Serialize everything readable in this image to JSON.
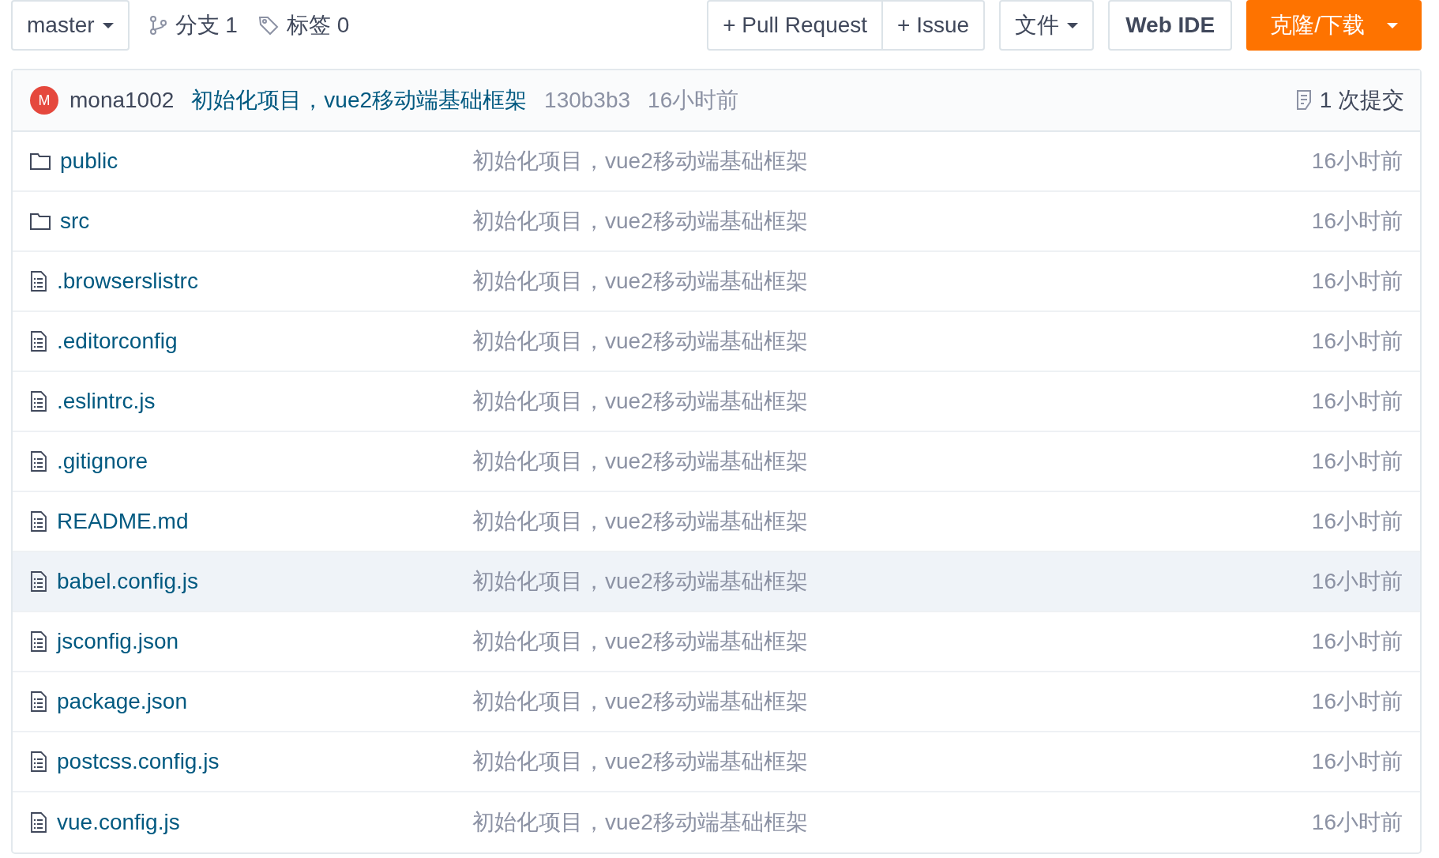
{
  "toolbar": {
    "branch": "master",
    "branches": "分支 1",
    "tags": "标签 0",
    "buttons": [
      {
        "label": "+ Pull Request",
        "kind": "group"
      },
      {
        "label": "+ Issue",
        "kind": "group"
      },
      {
        "label": "文件",
        "kind": "dropdown"
      },
      {
        "label": "Web IDE",
        "kind": "bold"
      },
      {
        "label": "克隆/下载",
        "kind": "primary"
      }
    ]
  },
  "commit": {
    "avatar": "M",
    "author": "mona1002",
    "message": "初始化项目，vue2移动端基础框架",
    "hash": "130b3b3",
    "time": "16小时前",
    "count": "1 次提交"
  },
  "files": [
    {
      "name": "public",
      "kind": "folder",
      "message": "初始化项目，vue2移动端基础框架",
      "time": "16小时前",
      "highlighted": false
    },
    {
      "name": "src",
      "kind": "folder",
      "message": "初始化项目，vue2移动端基础框架",
      "time": "16小时前",
      "highlighted": false
    },
    {
      "name": ".browserslistrc",
      "kind": "file",
      "message": "初始化项目，vue2移动端基础框架",
      "time": "16小时前",
      "highlighted": false
    },
    {
      "name": ".editorconfig",
      "kind": "file",
      "message": "初始化项目，vue2移动端基础框架",
      "time": "16小时前",
      "highlighted": false
    },
    {
      "name": ".eslintrc.js",
      "kind": "file",
      "message": "初始化项目，vue2移动端基础框架",
      "time": "16小时前",
      "highlighted": false
    },
    {
      "name": ".gitignore",
      "kind": "file",
      "message": "初始化项目，vue2移动端基础框架",
      "time": "16小时前",
      "highlighted": false
    },
    {
      "name": "README.md",
      "kind": "file",
      "message": "初始化项目，vue2移动端基础框架",
      "time": "16小时前",
      "highlighted": false
    },
    {
      "name": "babel.config.js",
      "kind": "file",
      "message": "初始化项目，vue2移动端基础框架",
      "time": "16小时前",
      "highlighted": true
    },
    {
      "name": "jsconfig.json",
      "kind": "file",
      "message": "初始化项目，vue2移动端基础框架",
      "time": "16小时前",
      "highlighted": false
    },
    {
      "name": "package.json",
      "kind": "file",
      "message": "初始化项目，vue2移动端基础框架",
      "time": "16小时前",
      "highlighted": false
    },
    {
      "name": "postcss.config.js",
      "kind": "file",
      "message": "初始化项目，vue2移动端基础框架",
      "time": "16小时前",
      "highlighted": false
    },
    {
      "name": "vue.config.js",
      "kind": "file",
      "message": "初始化项目，vue2移动端基础框架",
      "time": "16小时前",
      "highlighted": false
    }
  ]
}
